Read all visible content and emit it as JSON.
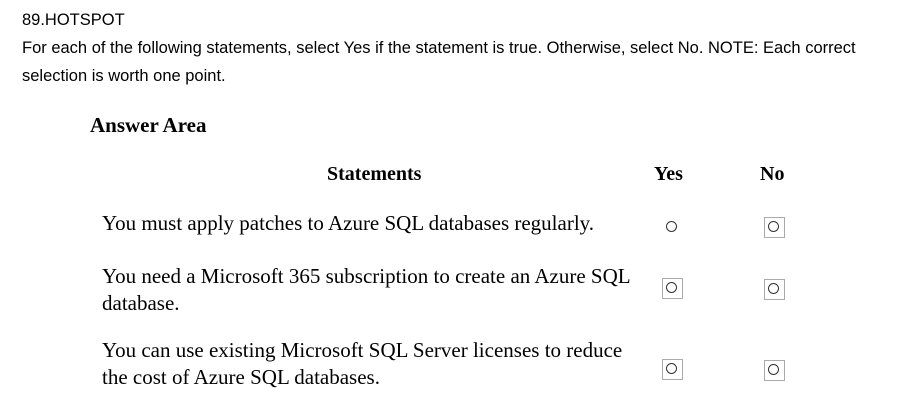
{
  "question": {
    "number_title": "89.HOTSPOT",
    "instructions": "For each of the following statements, select Yes if the statement is true. Otherwise, select No. NOTE: Each correct selection is worth one point."
  },
  "answer_area": {
    "title": "Answer Area",
    "columns": {
      "statements": "Statements",
      "yes": "Yes",
      "no": "No"
    },
    "rows": [
      {
        "statement": "You must apply patches to Azure SQL databases regularly."
      },
      {
        "statement": "You need a Microsoft 365 subscription to create an Azure SQL database."
      },
      {
        "statement": "You can use existing Microsoft SQL Server licenses to reduce the cost of Azure SQL databases."
      }
    ]
  }
}
